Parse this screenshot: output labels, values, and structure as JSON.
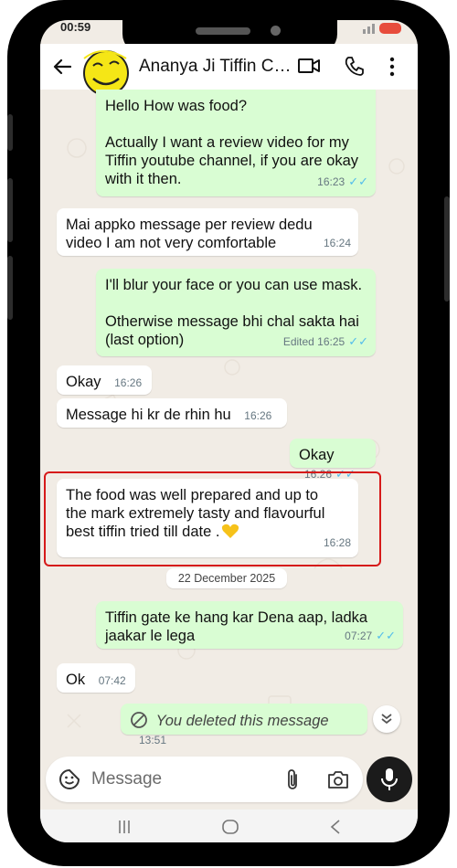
{
  "status_bar": {
    "time": "00:59"
  },
  "header": {
    "contact_name": "Ananya Ji Tiffin C…"
  },
  "messages": [
    {
      "dir": "out",
      "text_lines": [
        "Hello How was food?",
        "",
        "Actually I want a review video for my",
        "Tiffin youtube channel, if you are okay",
        "with it then."
      ],
      "time": "16:23"
    },
    {
      "dir": "in",
      "text_lines": [
        "Mai appko message per review dedu",
        "video I am not very comfortable"
      ],
      "time": "16:24"
    },
    {
      "dir": "out",
      "text_lines": [
        "I'll blur your face or you can use mask.",
        "",
        "Otherwise message bhi chal sakta hai",
        "(last option)"
      ],
      "time": "Edited 16:25"
    },
    {
      "dir": "in",
      "text_lines": [
        "Okay"
      ],
      "time": "16:26"
    },
    {
      "dir": "in",
      "text_lines": [
        "Message hi kr de rhin hu"
      ],
      "time": "16:26"
    },
    {
      "dir": "out",
      "text_lines": [
        "Okay"
      ],
      "time": "16:26"
    },
    {
      "dir": "in",
      "text_lines": [
        "The food was well prepared and up to",
        "the mark extremely tasty and flavourful",
        "best tiffin tried till date ."
      ],
      "time": "16:28",
      "highlighted": true
    },
    {
      "dir": "out",
      "text_lines": [
        "Tiffin gate ke hang kar Dena  aap, ladka",
        "jaakar le lega"
      ],
      "time": "07:27"
    },
    {
      "dir": "in",
      "text_lines": [
        "Ok"
      ],
      "time": "07:42"
    },
    {
      "dir": "out",
      "deleted_text": "You deleted this message",
      "time": "13:51"
    }
  ],
  "date_separator": "22 December 2025",
  "composer": {
    "placeholder": "Message"
  },
  "colors": {
    "outgoing_bubble": "#d9fdd3",
    "incoming_bubble": "#ffffff",
    "read_ticks": "#53bdeb",
    "highlight_border": "#d61a1a"
  },
  "icons": [
    "back-arrow-icon",
    "video-call-icon",
    "phone-call-icon",
    "more-options-icon",
    "emoji-icon",
    "attach-icon",
    "camera-icon",
    "mic-icon",
    "scroll-down-icon",
    "deleted-icon",
    "recents-nav-icon",
    "home-nav-icon",
    "back-nav-icon"
  ]
}
